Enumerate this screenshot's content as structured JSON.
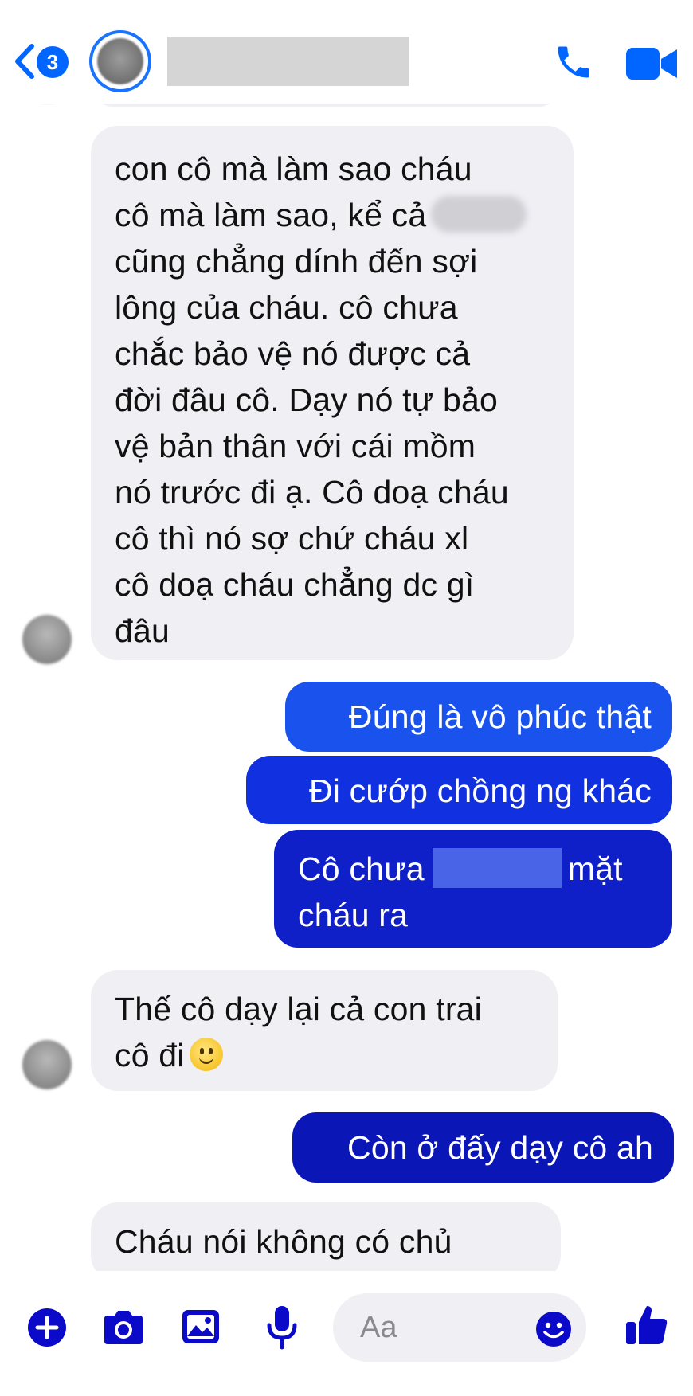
{
  "header": {
    "back_badge": "3",
    "icons": {
      "back": "chevron-left-icon",
      "call": "phone-icon",
      "video": "video-camera-icon"
    },
    "colors": {
      "accent": "#0066ff"
    }
  },
  "messages": [
    {
      "direction": "incoming",
      "lines": [
        "con cô mà làm sao cháu",
        "cô mà làm sao, kể cả",
        "cũng chẳng dính đến sợi",
        "lông của cháu. cô chưa",
        "chắc bảo vệ nó được cả",
        "đời đâu cô. Dạy nó tự bảo",
        "vệ bản thân với cái mồm",
        "nó trước đi ạ. Cô doạ cháu",
        "cô thì nó sợ chứ cháu xl",
        "cô doạ cháu chẳng dc gì",
        "đâu"
      ]
    },
    {
      "direction": "outgoing",
      "text": "Đúng là vô phúc thật"
    },
    {
      "direction": "outgoing",
      "text": "Đi cướp chồng ng khác"
    },
    {
      "direction": "outgoing",
      "lines": [
        "Cô chưa",
        "mặt",
        "cháu ra"
      ]
    },
    {
      "direction": "incoming",
      "lines": [
        "Thế cô dạy lại cả con trai",
        "cô đi"
      ],
      "emoji": "slightly-smiling-face-icon"
    },
    {
      "direction": "outgoing",
      "text": "Còn ở đấy dạy cô ah"
    },
    {
      "direction": "incoming",
      "text": "Cháu nói không có chủ"
    }
  ],
  "composer": {
    "placeholder": "Aa",
    "icons": [
      "plus-icon",
      "camera-icon",
      "photo-icon",
      "microphone-icon",
      "emoji-icon",
      "thumbs-up-icon"
    ],
    "colors": {
      "icon": "#0a0ac8"
    }
  }
}
